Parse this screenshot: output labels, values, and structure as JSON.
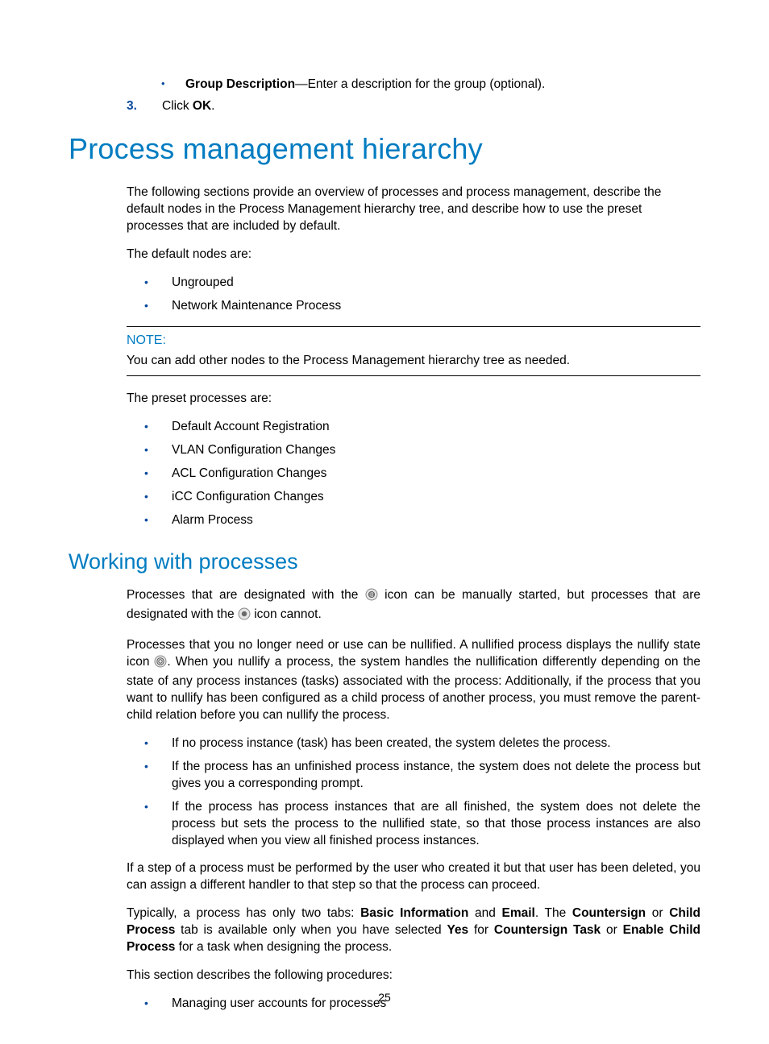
{
  "top_sub_bullet": {
    "label": "Group Description",
    "dash": "—",
    "text": "Enter a description for the group (optional)."
  },
  "step3": {
    "prefix": "Click ",
    "bold": "OK",
    "suffix": "."
  },
  "h1": "Process management hierarchy",
  "intro": "The following sections provide an overview of processes and process management, describe the default nodes in the Process Management hierarchy tree, and describe how to use the preset processes that are included by default.",
  "default_nodes_lead": "The default nodes are:",
  "default_nodes": [
    "Ungrouped",
    "Network Maintenance Process"
  ],
  "note": {
    "label": "NOTE:",
    "text": "You can add other nodes to the Process Management hierarchy tree as needed."
  },
  "preset_lead": "The preset processes are:",
  "preset_list": [
    "Default Account Registration",
    "VLAN Configuration Changes",
    "ACL Configuration Changes",
    "iCC Configuration Changes",
    "Alarm Process"
  ],
  "h2": "Working with processes",
  "wp_p1": {
    "a": "Processes that are designated with the ",
    "b": " icon can be manually started, but processes that are designated with the ",
    "c": " icon cannot."
  },
  "wp_p2": {
    "a": "Processes that you no longer need or use can be nullified. A nullified process displays the nullify state icon ",
    "b": ". When you nullify a process, the system handles the nullification differently depending on the state of any process instances (tasks) associated with the process: Additionally, if the process that you want to nullify has been configured as a child process of another process, you must remove the parent-child relation before you can nullify the process."
  },
  "wp_bullets": [
    "If no process instance (task) has been created, the system deletes the process.",
    "If the process has an unfinished process instance, the system does not delete the process but gives you a corresponding prompt.",
    "If the process has process instances that are all finished, the system does not delete the process but sets the process to the nullified state, so that those process instances are also displayed when you view all finished process instances."
  ],
  "wp_p3": "If a step of a process must be performed by the user who created it but that user has been deleted, you can assign a different handler to that step so that the process can proceed.",
  "wp_p4": {
    "a": "Typically, a process has only two tabs: ",
    "b1": "Basic Information",
    "mid1": " and ",
    "b2": "Email",
    "mid2": ". The ",
    "b3": "Countersign",
    "mid3": " or ",
    "b4": "Child Process",
    "mid4": " tab is available only when you have selected ",
    "b5": "Yes",
    "mid5": " for ",
    "b6": "Countersign Task",
    "mid6": " or ",
    "b7": "Enable Child Process",
    "mid7": " for a task when designing the process."
  },
  "wp_p5": "This section describes the following procedures:",
  "wp_last_bullets": [
    "Managing user accounts for processes"
  ],
  "page_number": "25"
}
